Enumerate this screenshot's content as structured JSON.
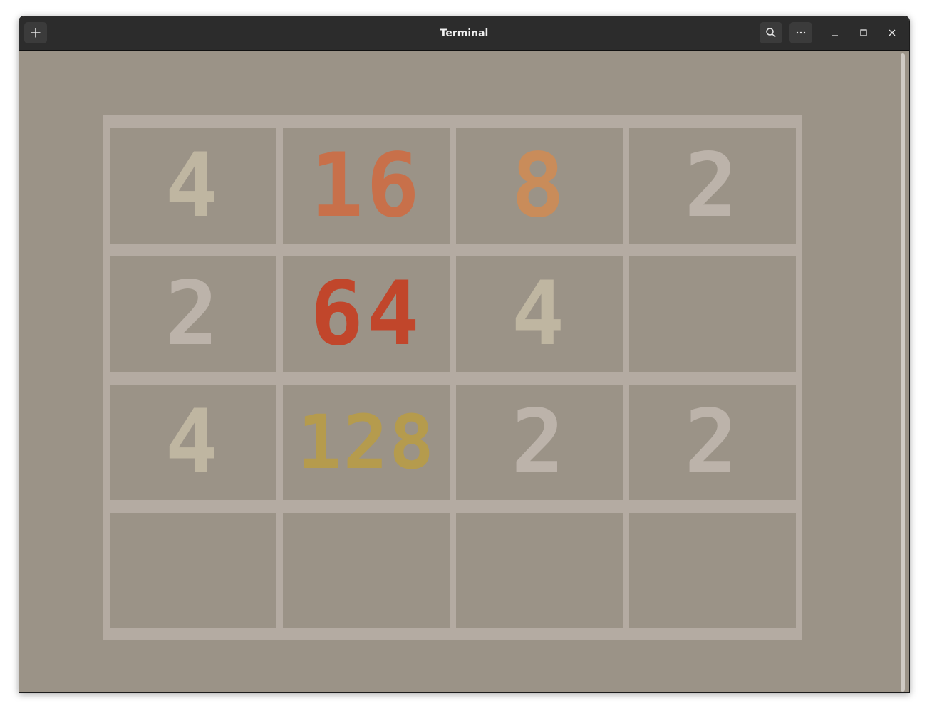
{
  "window": {
    "title": "Terminal",
    "new_tab_icon": "plus-icon",
    "search_icon": "search-icon",
    "menu_icon": "ellipsis-icon",
    "minimize_icon": "minimize-icon",
    "maximize_icon": "maximize-icon",
    "close_icon": "close-icon"
  },
  "game": {
    "rows": [
      [
        "4",
        "16",
        "8",
        "2"
      ],
      [
        "2",
        "64",
        "4",
        ""
      ],
      [
        "4",
        "128",
        "2",
        "2"
      ],
      [
        "",
        "",
        "",
        ""
      ]
    ],
    "tile_colors": {
      "2": "#bcb3aa",
      "4": "#bfb6a1",
      "8": "#c98c5a",
      "16": "#c8704a",
      "64": "#c1462b",
      "128": "#b59b4d"
    },
    "board_color": "#b4aba2",
    "cell_color": "#9b9387"
  }
}
